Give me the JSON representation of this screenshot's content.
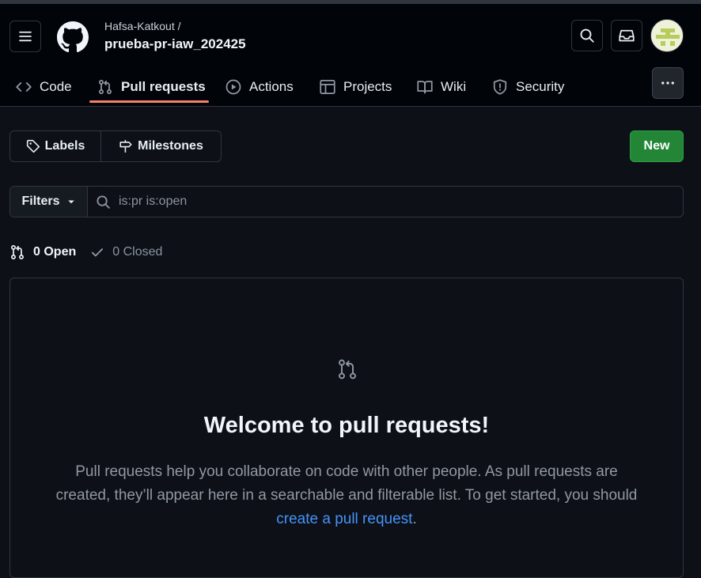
{
  "repo_header": {
    "owner": "Hafsa-Katkout /",
    "name": "prueba-pr-iaw_202425",
    "avatar": "user-avatar"
  },
  "nav_tabs": [
    {
      "label": "Code",
      "icon": "code-icon"
    },
    {
      "label": "Pull requests",
      "icon": "git-pull-request-icon",
      "active": true
    },
    {
      "label": "Actions",
      "icon": "play-icon"
    },
    {
      "label": "Projects",
      "icon": "table-icon"
    },
    {
      "label": "Wiki",
      "icon": "book-icon"
    },
    {
      "label": "Security",
      "icon": "shield-icon"
    }
  ],
  "toolbar": {
    "labels_label": "Labels",
    "milestones_label": "Milestones",
    "new_label": "New"
  },
  "filter": {
    "button_label": "Filters",
    "query": "is:pr is:open"
  },
  "states": {
    "open_label": "0 Open",
    "closed_label": "0 Closed"
  },
  "blankslate": {
    "title": "Welcome to pull requests!",
    "description_before": "Pull requests help you collaborate on code with other people. As pull requests are created, they’ll appear here in a searchable and filterable list. To get started, you should ",
    "link_text": "create a pull request",
    "description_after": "."
  },
  "colors": {
    "accent_tab": "#f78166",
    "new_button": "#238636",
    "link": "#4493f8",
    "background": "#0d1117",
    "header_background": "#010409"
  }
}
